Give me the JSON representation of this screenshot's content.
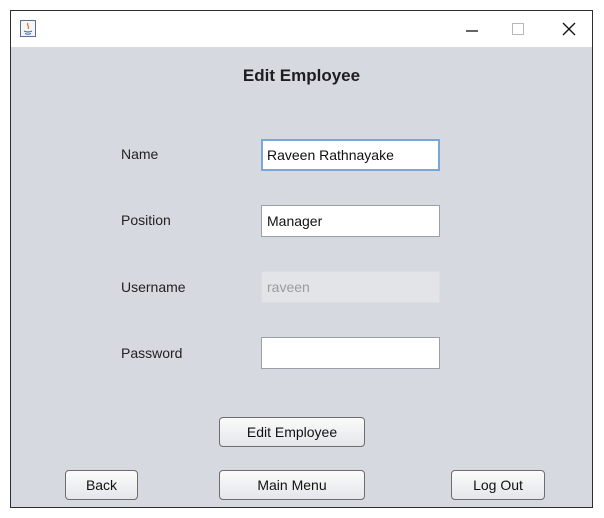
{
  "window": {
    "title": "",
    "controls": {
      "minimize_icon": "minimize-icon",
      "maximize_icon": "maximize-icon",
      "close_icon": "close-icon"
    }
  },
  "form": {
    "title": "Edit Employee",
    "fields": {
      "name": {
        "label": "Name",
        "value": "Raveen Rathnayake"
      },
      "position": {
        "label": "Position",
        "value": "Manager"
      },
      "username": {
        "label": "Username",
        "value": "raveen"
      },
      "password": {
        "label": "Password",
        "value": ""
      }
    },
    "buttons": {
      "edit": "Edit Employee",
      "back": "Back",
      "main_menu": "Main Menu",
      "logout": "Log Out"
    }
  },
  "colors": {
    "window_background": "#d6d9df",
    "focus_border": "#7aa6d8",
    "disabled_text": "#9c9c9c"
  }
}
